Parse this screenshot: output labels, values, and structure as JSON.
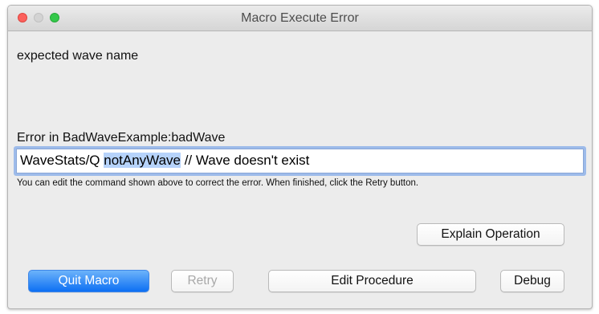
{
  "window": {
    "title": "Macro Execute Error"
  },
  "message": "expected wave name",
  "error_location": "Error in  BadWaveExample:badWave",
  "command": {
    "before": "WaveStats/Q ",
    "selected": "notAnyWave",
    "after": " // Wave doesn't exist"
  },
  "hint": "You can edit the command shown above to correct the error. When finished, click the Retry button.",
  "buttons": {
    "explain_operation": "Explain Operation",
    "quit_macro": "Quit Macro",
    "retry": "Retry",
    "edit_procedure": "Edit Procedure",
    "debug": "Debug"
  },
  "colors": {
    "primary_button": "#1a7cf5",
    "selection": "#b6d3fb",
    "focus_ring": "#9dbbea"
  }
}
